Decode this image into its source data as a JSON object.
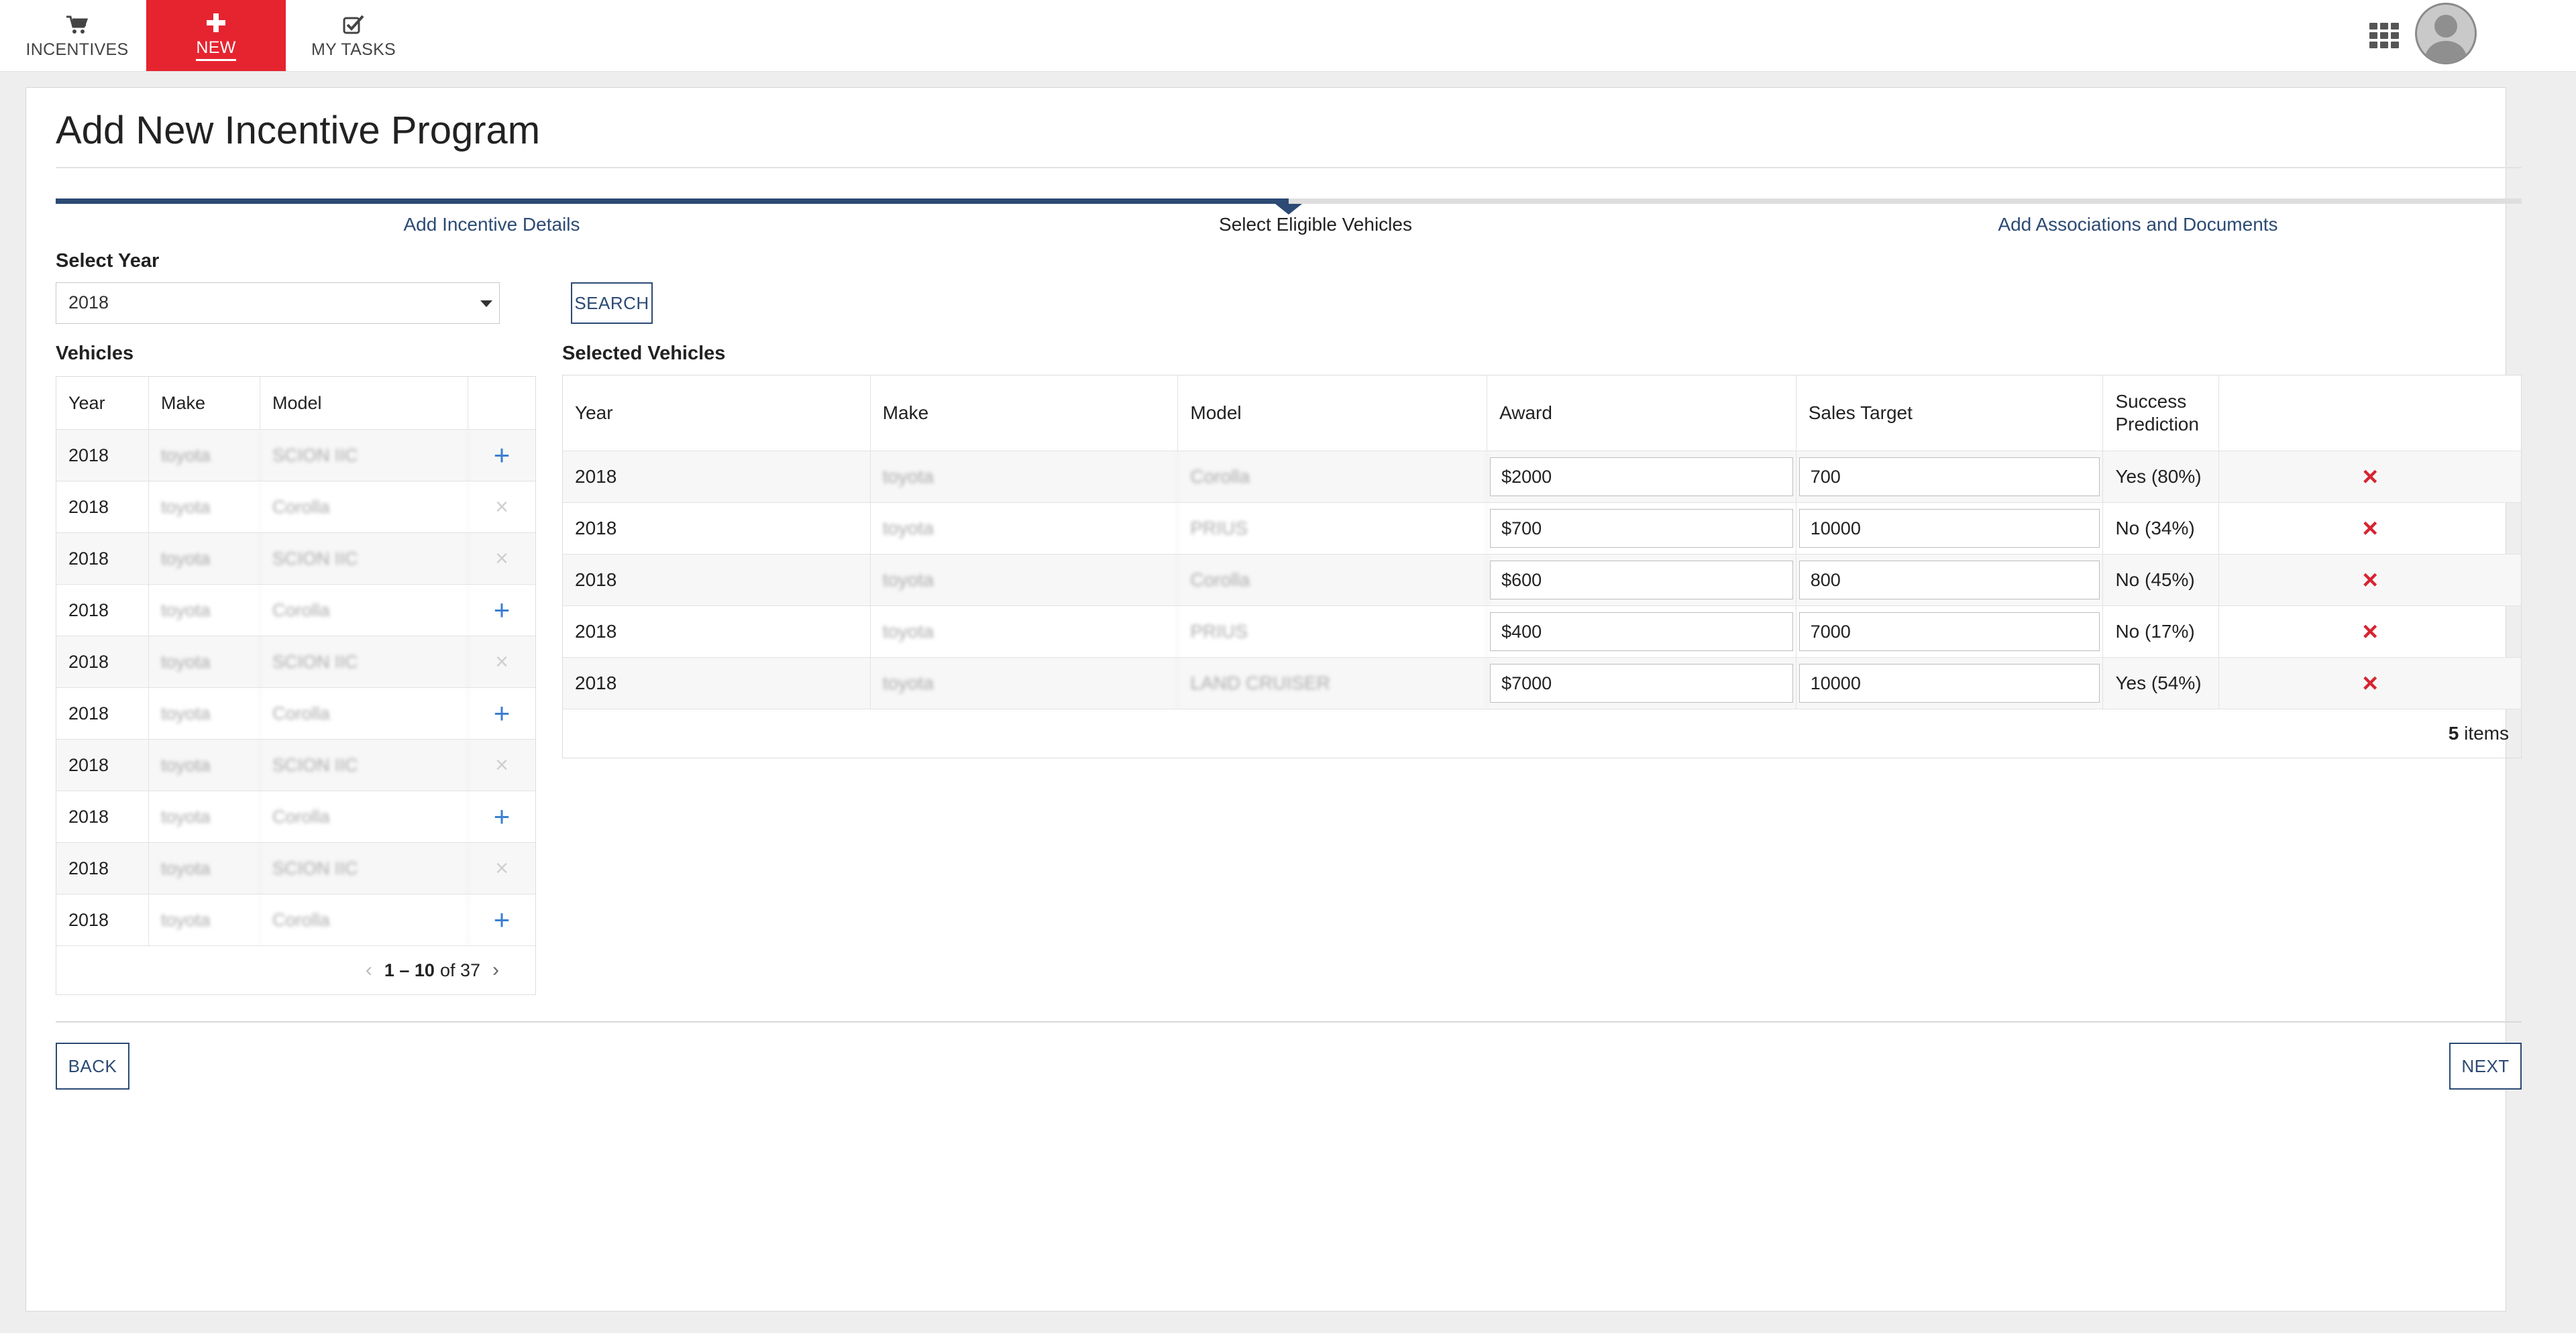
{
  "nav": {
    "tabs": [
      {
        "label": "INCENTIVES",
        "icon": "cart-icon"
      },
      {
        "label": "NEW",
        "icon": "plus-icon"
      },
      {
        "label": "MY TASKS",
        "icon": "checkbox-icon"
      }
    ],
    "active_tab": "NEW",
    "accent_color": "#e52430"
  },
  "page": {
    "title": "Add New Incentive Program"
  },
  "stepper": {
    "steps": [
      "Add Incentive Details",
      "Select Eligible Vehicles",
      "Add Associations and Documents"
    ],
    "current_step": "Select Eligible Vehicles",
    "progress_color": "#2c4a74"
  },
  "filters": {
    "select_year_label": "Select Year",
    "year_value": "2018",
    "search_label": "SEARCH"
  },
  "vehicles": {
    "title": "Vehicles",
    "columns": [
      "Year",
      "Make",
      "Model"
    ],
    "rows": [
      {
        "year": "2018",
        "make": "toyota",
        "model": "SCION IIC",
        "action": "add"
      },
      {
        "year": "2018",
        "make": "toyota",
        "model": "Corolla",
        "action": "disabled"
      },
      {
        "year": "2018",
        "make": "toyota",
        "model": "SCION IIC",
        "action": "disabled"
      },
      {
        "year": "2018",
        "make": "toyota",
        "model": "Corolla",
        "action": "add"
      },
      {
        "year": "2018",
        "make": "toyota",
        "model": "SCION IIC",
        "action": "disabled"
      },
      {
        "year": "2018",
        "make": "toyota",
        "model": "Corolla",
        "action": "add"
      },
      {
        "year": "2018",
        "make": "toyota",
        "model": "SCION IIC",
        "action": "disabled"
      },
      {
        "year": "2018",
        "make": "toyota",
        "model": "Corolla",
        "action": "add"
      },
      {
        "year": "2018",
        "make": "toyota",
        "model": "SCION IIC",
        "action": "disabled"
      },
      {
        "year": "2018",
        "make": "toyota",
        "model": "Corolla",
        "action": "add"
      }
    ],
    "pager": {
      "range": "1 – 10",
      "of_label": "of 37"
    }
  },
  "selected": {
    "title": "Selected Vehicles",
    "columns": [
      "Year",
      "Make",
      "Model",
      "Award",
      "Sales Target",
      "Success Prediction"
    ],
    "rows": [
      {
        "year": "2018",
        "make": "toyota",
        "model": "Corolla",
        "award": "$2000",
        "target": "700",
        "prediction": "Yes (80%)"
      },
      {
        "year": "2018",
        "make": "toyota",
        "model": "PRIUS",
        "award": "$700",
        "target": "10000",
        "prediction": "No (34%)"
      },
      {
        "year": "2018",
        "make": "toyota",
        "model": "Corolla",
        "award": "$600",
        "target": "800",
        "prediction": "No (45%)"
      },
      {
        "year": "2018",
        "make": "toyota",
        "model": "PRIUS",
        "award": "$400",
        "target": "7000",
        "prediction": "No (17%)"
      },
      {
        "year": "2018",
        "make": "toyota",
        "model": "LAND CRUISER",
        "award": "$7000",
        "target": "10000",
        "prediction": "Yes (54%)"
      }
    ],
    "count": "5",
    "count_suffix": " items",
    "remove_color": "#d72430"
  },
  "actions": {
    "back_label": "BACK",
    "next_label": "NEXT"
  }
}
